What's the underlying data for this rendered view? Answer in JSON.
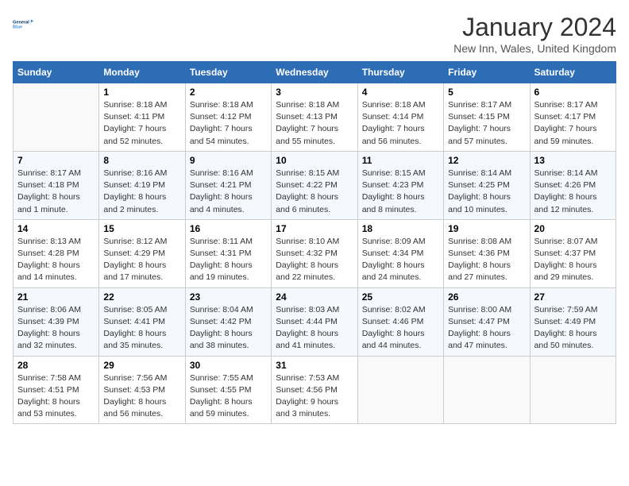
{
  "logo": {
    "line1": "General",
    "line2": "Blue"
  },
  "title": "January 2024",
  "subtitle": "New Inn, Wales, United Kingdom",
  "days_of_week": [
    "Sunday",
    "Monday",
    "Tuesday",
    "Wednesday",
    "Thursday",
    "Friday",
    "Saturday"
  ],
  "weeks": [
    [
      {
        "day": "",
        "info": ""
      },
      {
        "day": "1",
        "info": "Sunrise: 8:18 AM\nSunset: 4:11 PM\nDaylight: 7 hours\nand 52 minutes."
      },
      {
        "day": "2",
        "info": "Sunrise: 8:18 AM\nSunset: 4:12 PM\nDaylight: 7 hours\nand 54 minutes."
      },
      {
        "day": "3",
        "info": "Sunrise: 8:18 AM\nSunset: 4:13 PM\nDaylight: 7 hours\nand 55 minutes."
      },
      {
        "day": "4",
        "info": "Sunrise: 8:18 AM\nSunset: 4:14 PM\nDaylight: 7 hours\nand 56 minutes."
      },
      {
        "day": "5",
        "info": "Sunrise: 8:17 AM\nSunset: 4:15 PM\nDaylight: 7 hours\nand 57 minutes."
      },
      {
        "day": "6",
        "info": "Sunrise: 8:17 AM\nSunset: 4:17 PM\nDaylight: 7 hours\nand 59 minutes."
      }
    ],
    [
      {
        "day": "7",
        "info": "Sunrise: 8:17 AM\nSunset: 4:18 PM\nDaylight: 8 hours\nand 1 minute."
      },
      {
        "day": "8",
        "info": "Sunrise: 8:16 AM\nSunset: 4:19 PM\nDaylight: 8 hours\nand 2 minutes."
      },
      {
        "day": "9",
        "info": "Sunrise: 8:16 AM\nSunset: 4:21 PM\nDaylight: 8 hours\nand 4 minutes."
      },
      {
        "day": "10",
        "info": "Sunrise: 8:15 AM\nSunset: 4:22 PM\nDaylight: 8 hours\nand 6 minutes."
      },
      {
        "day": "11",
        "info": "Sunrise: 8:15 AM\nSunset: 4:23 PM\nDaylight: 8 hours\nand 8 minutes."
      },
      {
        "day": "12",
        "info": "Sunrise: 8:14 AM\nSunset: 4:25 PM\nDaylight: 8 hours\nand 10 minutes."
      },
      {
        "day": "13",
        "info": "Sunrise: 8:14 AM\nSunset: 4:26 PM\nDaylight: 8 hours\nand 12 minutes."
      }
    ],
    [
      {
        "day": "14",
        "info": "Sunrise: 8:13 AM\nSunset: 4:28 PM\nDaylight: 8 hours\nand 14 minutes."
      },
      {
        "day": "15",
        "info": "Sunrise: 8:12 AM\nSunset: 4:29 PM\nDaylight: 8 hours\nand 17 minutes."
      },
      {
        "day": "16",
        "info": "Sunrise: 8:11 AM\nSunset: 4:31 PM\nDaylight: 8 hours\nand 19 minutes."
      },
      {
        "day": "17",
        "info": "Sunrise: 8:10 AM\nSunset: 4:32 PM\nDaylight: 8 hours\nand 22 minutes."
      },
      {
        "day": "18",
        "info": "Sunrise: 8:09 AM\nSunset: 4:34 PM\nDaylight: 8 hours\nand 24 minutes."
      },
      {
        "day": "19",
        "info": "Sunrise: 8:08 AM\nSunset: 4:36 PM\nDaylight: 8 hours\nand 27 minutes."
      },
      {
        "day": "20",
        "info": "Sunrise: 8:07 AM\nSunset: 4:37 PM\nDaylight: 8 hours\nand 29 minutes."
      }
    ],
    [
      {
        "day": "21",
        "info": "Sunrise: 8:06 AM\nSunset: 4:39 PM\nDaylight: 8 hours\nand 32 minutes."
      },
      {
        "day": "22",
        "info": "Sunrise: 8:05 AM\nSunset: 4:41 PM\nDaylight: 8 hours\nand 35 minutes."
      },
      {
        "day": "23",
        "info": "Sunrise: 8:04 AM\nSunset: 4:42 PM\nDaylight: 8 hours\nand 38 minutes."
      },
      {
        "day": "24",
        "info": "Sunrise: 8:03 AM\nSunset: 4:44 PM\nDaylight: 8 hours\nand 41 minutes."
      },
      {
        "day": "25",
        "info": "Sunrise: 8:02 AM\nSunset: 4:46 PM\nDaylight: 8 hours\nand 44 minutes."
      },
      {
        "day": "26",
        "info": "Sunrise: 8:00 AM\nSunset: 4:47 PM\nDaylight: 8 hours\nand 47 minutes."
      },
      {
        "day": "27",
        "info": "Sunrise: 7:59 AM\nSunset: 4:49 PM\nDaylight: 8 hours\nand 50 minutes."
      }
    ],
    [
      {
        "day": "28",
        "info": "Sunrise: 7:58 AM\nSunset: 4:51 PM\nDaylight: 8 hours\nand 53 minutes."
      },
      {
        "day": "29",
        "info": "Sunrise: 7:56 AM\nSunset: 4:53 PM\nDaylight: 8 hours\nand 56 minutes."
      },
      {
        "day": "30",
        "info": "Sunrise: 7:55 AM\nSunset: 4:55 PM\nDaylight: 8 hours\nand 59 minutes."
      },
      {
        "day": "31",
        "info": "Sunrise: 7:53 AM\nSunset: 4:56 PM\nDaylight: 9 hours\nand 3 minutes."
      },
      {
        "day": "",
        "info": ""
      },
      {
        "day": "",
        "info": ""
      },
      {
        "day": "",
        "info": ""
      }
    ]
  ]
}
